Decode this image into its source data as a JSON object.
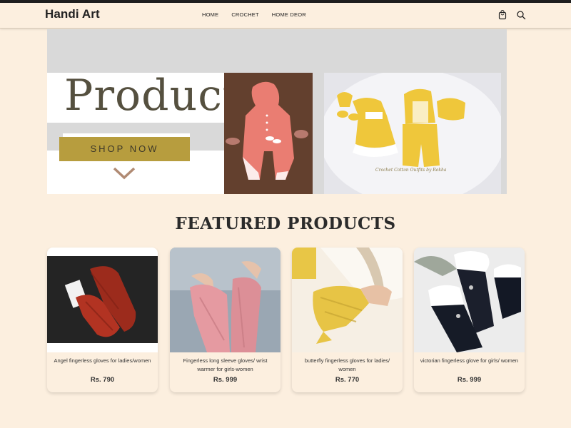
{
  "header": {
    "brand": "Handi Art",
    "nav": [
      "HOME",
      "CROCHET",
      "HOME DEOR"
    ],
    "icons": [
      "cart-icon",
      "search-icon"
    ]
  },
  "banner": {
    "headline": "Product",
    "cta_label": "SHOP NOW",
    "photo_caption": "Crochet Cotton Outfits by Rekha"
  },
  "featured": {
    "title": "FEATURED PRODUCTS",
    "products": [
      {
        "name": "Angel fingerless gloves for ladies/women",
        "price": "Rs. 790"
      },
      {
        "name": "Fingerless long sleeve gloves/ wrist warmer for girls-women",
        "price": "Rs. 999"
      },
      {
        "name": "butterfly fingerless gloves for ladies/ women",
        "price": "Rs. 770"
      },
      {
        "name": "victorian fingerless glove for girls/ women",
        "price": "Rs. 999"
      }
    ]
  },
  "colors": {
    "page_bg": "#fcefdf",
    "cta_bg": "#b79d3e",
    "headline": "#55503f"
  }
}
